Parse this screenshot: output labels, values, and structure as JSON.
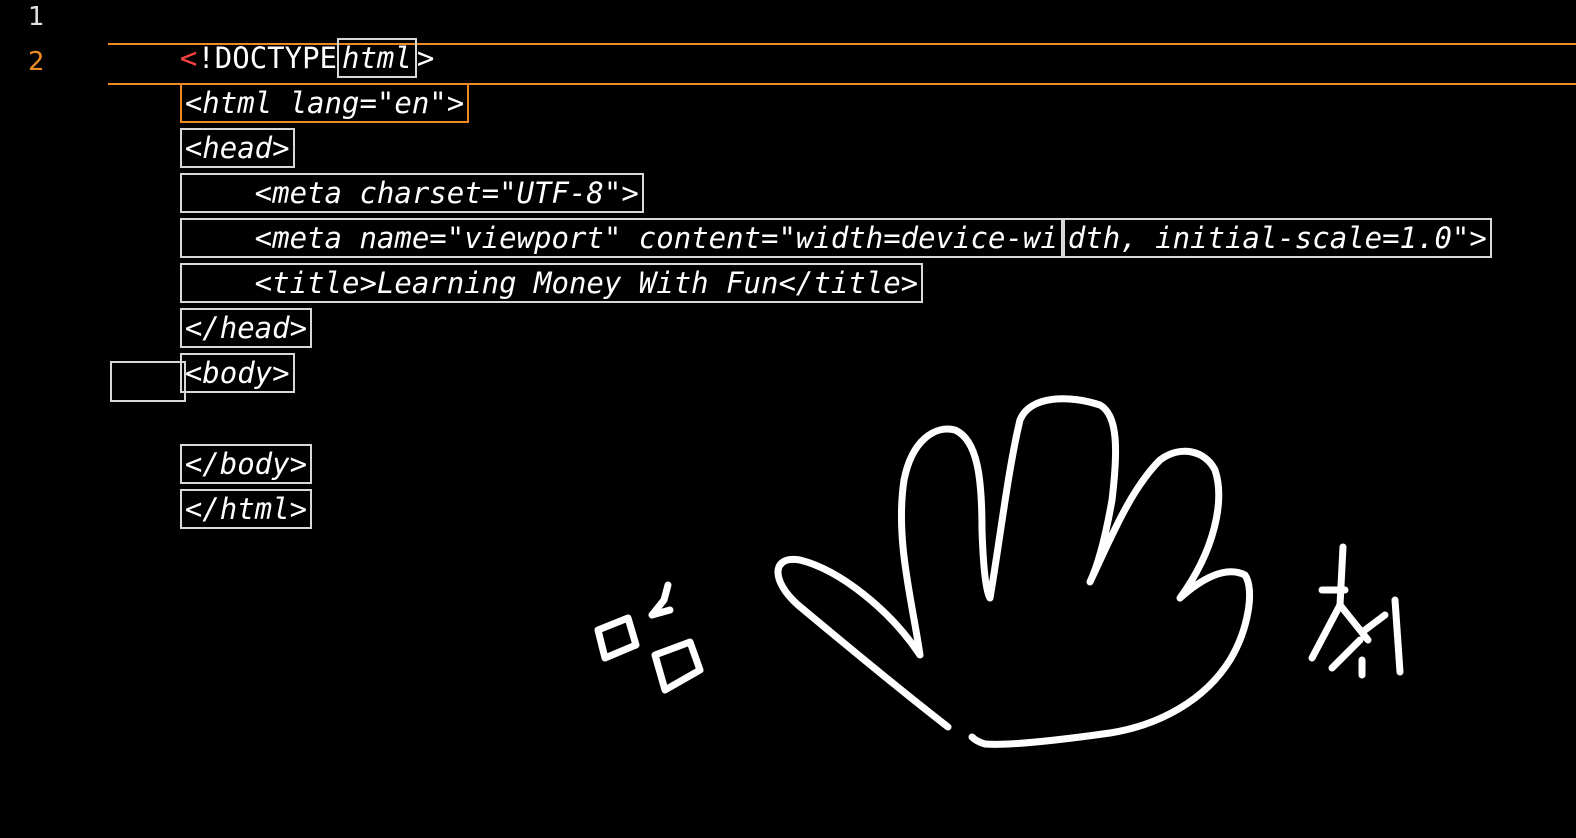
{
  "editor": {
    "line_numbers": [
      "1",
      "2"
    ],
    "lines": [
      {
        "type": "doctype",
        "lt": "<",
        "keyword": "!DOCTYPE",
        "name": "html",
        "gt": ">"
      },
      {
        "type": "code",
        "text": "<html lang=\"en\">",
        "active": true
      },
      {
        "type": "code",
        "text": "<head>"
      },
      {
        "type": "code",
        "text": "    <meta charset=\"UTF-8\">"
      },
      {
        "type": "code",
        "text": "    <meta name=\"viewport\" content=\"width=device-wi",
        "text_b": "dth, initial-scale=1.0\">"
      },
      {
        "type": "code",
        "text": "    <title>Learning Money With Fun</title>"
      },
      {
        "type": "code",
        "text": "</head>"
      },
      {
        "type": "code",
        "text": "<body>"
      },
      {
        "type": "empty",
        "text": ""
      },
      {
        "type": "code",
        "text": "</body>"
      },
      {
        "type": "code",
        "text": "</html>"
      }
    ]
  },
  "colors": {
    "active_accent": "#f08a24",
    "doctype_lt": "#ff4040",
    "box_border": "#d8d8d8",
    "background": "#000000"
  },
  "drawing": {
    "description_icon": "hand-drawn-waving-hand-icon",
    "left_glyph": "엄",
    "right_glyph": "처"
  }
}
